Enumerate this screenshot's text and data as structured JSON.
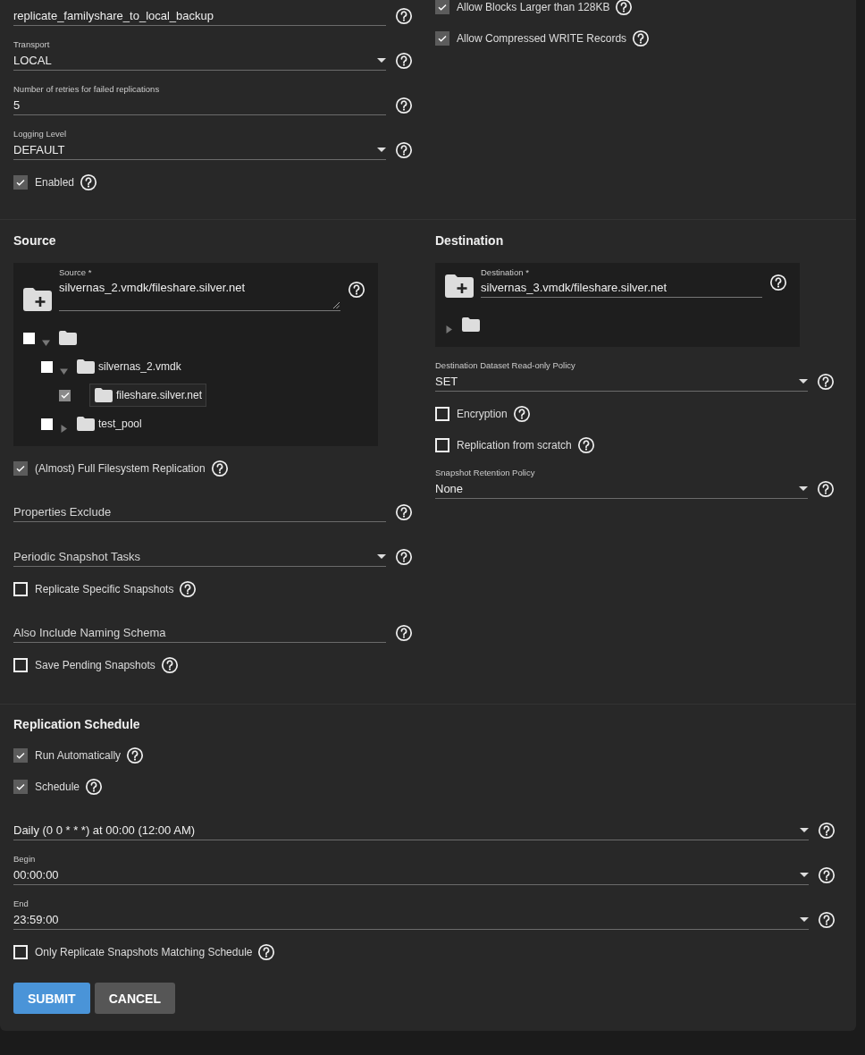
{
  "general": {
    "columns": [
      {
        "items": [
          {
            "kind": "input",
            "value": "replicate_familyshare_to_local_backup"
          },
          {
            "kind": "select",
            "label": "Transport",
            "value": "LOCAL"
          },
          {
            "kind": "input",
            "label": "Number of retries for failed replications",
            "value": "5"
          },
          {
            "kind": "select",
            "label": "Logging Level",
            "value": "DEFAULT"
          },
          {
            "kind": "checkbox",
            "label": "Enabled",
            "checked": true
          }
        ]
      },
      {
        "items": [
          {
            "kind": "checkbox",
            "label": "Allow Blocks Larger than 128KB",
            "checked": true
          },
          {
            "kind": "checkbox",
            "label": "Allow Compressed WRITE Records",
            "checked": true
          }
        ]
      }
    ]
  },
  "source": {
    "title": "Source",
    "items": [
      {
        "kind": "picker",
        "label": "Source *",
        "value": "silvernas_2.vmdk/fileshare.silver.net",
        "multiline": true,
        "tree": [
          {
            "checked": false,
            "expanded": true,
            "selected": false,
            "children": [
              {
                "name": "silvernas_2.vmdk",
                "checked": false,
                "expanded": true,
                "selected": false,
                "children": [
                  {
                    "name": "fileshare.silver.net",
                    "checked": true,
                    "selected": true
                  }
                ]
              },
              {
                "name": "test_pool",
                "checked": false,
                "expanded": false,
                "selected": false
              }
            ]
          }
        ]
      },
      {
        "kind": "checkbox",
        "label": "(Almost) Full Filesystem Replication",
        "checked": true
      },
      {
        "kind": "input",
        "placeholder": "Properties Exclude"
      },
      {
        "kind": "select",
        "placeholder": "Periodic Snapshot Tasks"
      },
      {
        "kind": "checkbox",
        "label": "Replicate Specific Snapshots",
        "checked": false
      },
      {
        "kind": "input",
        "placeholder": "Also Include Naming Schema"
      },
      {
        "kind": "checkbox",
        "label": "Save Pending Snapshots",
        "checked": false
      }
    ]
  },
  "destination": {
    "title": "Destination",
    "items": [
      {
        "kind": "picker",
        "label": "Destination *",
        "value": "silvernas_3.vmdk/fileshare.silver.net",
        "multiline": false,
        "tree": [
          {
            "expanded": false,
            "selected": false
          }
        ]
      },
      {
        "kind": "select",
        "label": "Destination Dataset Read-only Policy",
        "value": "SET"
      },
      {
        "kind": "checkbox",
        "label": "Encryption",
        "checked": false
      },
      {
        "kind": "checkbox",
        "label": "Replication from scratch",
        "checked": false
      },
      {
        "kind": "select",
        "label": "Snapshot Retention Policy",
        "value": "None"
      }
    ]
  },
  "schedule": {
    "title": "Replication Schedule",
    "items": [
      {
        "kind": "checkbox",
        "label": "Run Automatically",
        "checked": true
      },
      {
        "kind": "checkbox",
        "label": "Schedule",
        "checked": true
      },
      {
        "kind": "select",
        "value": "Daily (0 0 * * *) at 00:00 (12:00 AM)"
      },
      {
        "kind": "select",
        "label": "Begin",
        "value": "00:00:00"
      },
      {
        "kind": "select",
        "label": "End",
        "value": "23:59:00"
      },
      {
        "kind": "checkbox",
        "label": "Only Replicate Snapshots Matching Schedule",
        "checked": false
      }
    ]
  },
  "buttons": [
    {
      "label": "SUBMIT",
      "kind": "primary"
    },
    {
      "label": "CANCEL",
      "kind": "secondary"
    }
  ]
}
